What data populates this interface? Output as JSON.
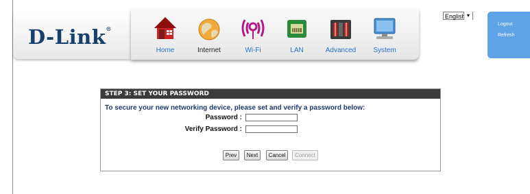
{
  "brand": {
    "name": "D-Link",
    "reg": "®"
  },
  "nav": {
    "items": [
      {
        "label": "Home",
        "icon": "home-icon"
      },
      {
        "label": "Internet",
        "icon": "internet-icon"
      },
      {
        "label": "Wi-Fi",
        "icon": "wifi-icon"
      },
      {
        "label": "LAN",
        "icon": "lan-icon"
      },
      {
        "label": "Advanced",
        "icon": "advanced-icon"
      },
      {
        "label": "System",
        "icon": "system-icon"
      }
    ]
  },
  "language": {
    "selected": "English"
  },
  "account": {
    "logout": "Logout",
    "refresh": "Refresh"
  },
  "wizard": {
    "title": "STEP 3: SET YOUR PASSWORD",
    "instructions": "To secure your new networking device, please set and verify a password below:",
    "password_label": "Password :",
    "verify_label": "Verify Password :",
    "password_value": "",
    "verify_value": "",
    "buttons": {
      "prev": "Prev",
      "next": "Next",
      "cancel": "Cancel",
      "connect": "Connect"
    }
  },
  "colors": {
    "brand_blue": "#17406d",
    "nav_link": "#2a6fc9",
    "account_bg": "#5ea3e8",
    "title_bar": "#3b3b3b"
  }
}
